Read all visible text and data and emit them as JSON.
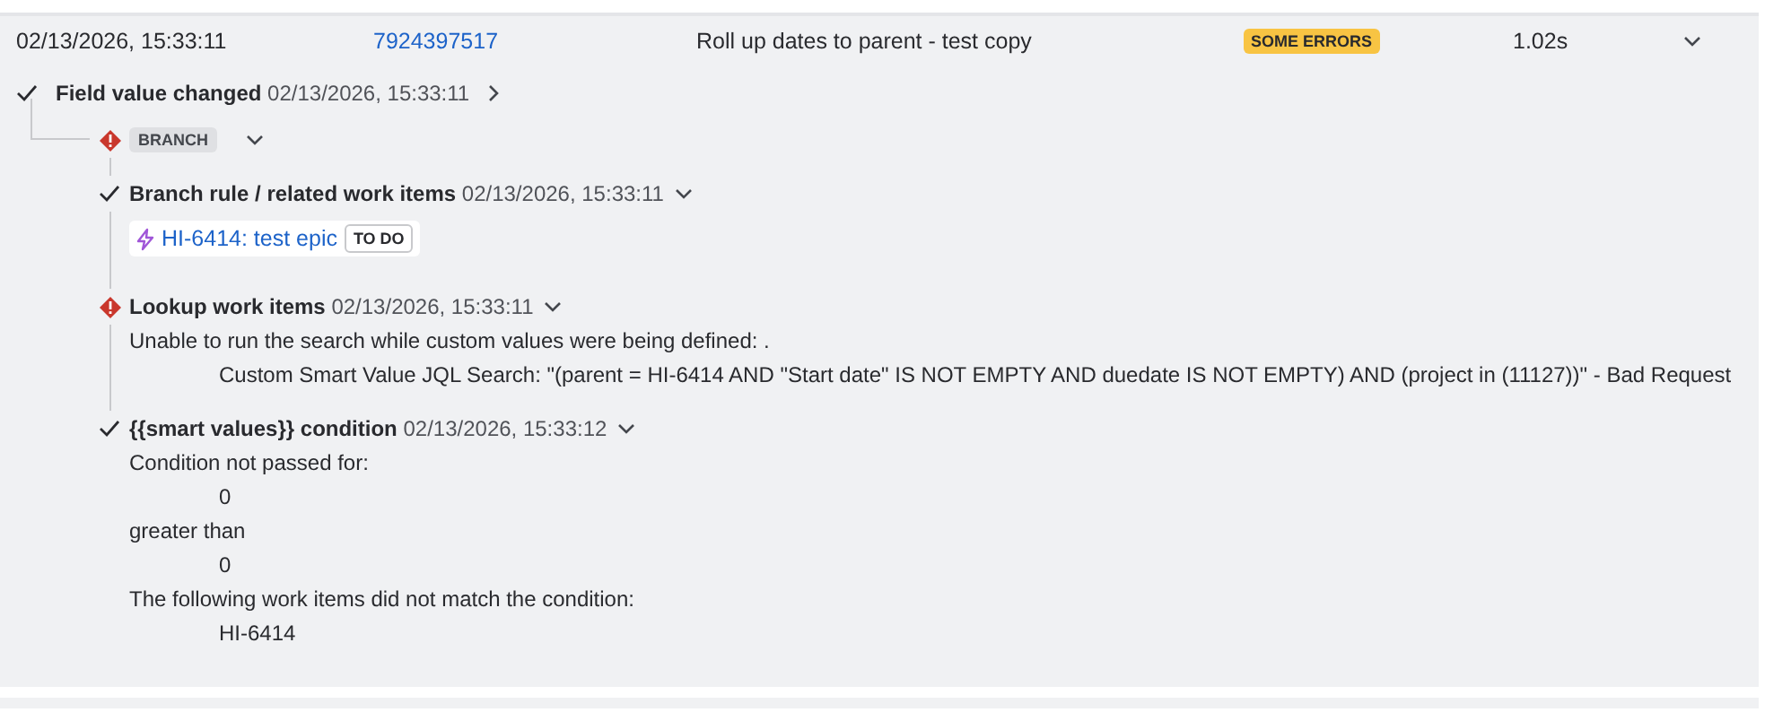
{
  "run": {
    "date": "02/13/2026, 15:33:11",
    "id": "7924397517",
    "rule": "Roll up dates to parent - test copy",
    "status": "SOME ERRORS",
    "duration": "1.02s",
    "expanded": true
  },
  "trigger": {
    "error": false,
    "title": "Field value changed",
    "time": "02/13/2026, 15:33:11",
    "expanded": false
  },
  "components": [
    {
      "kind": "branch",
      "error": true,
      "label": "BRANCH",
      "expanded": true,
      "children": [
        {
          "error": false,
          "title": "Branch rule / related work items",
          "time": "02/13/2026, 15:33:11",
          "expanded": true,
          "items": [
            {
              "key": "HI-6414: test epic",
              "status": "TO DO"
            }
          ]
        },
        {
          "error": true,
          "title": "Lookup work items",
          "time": "02/13/2026, 15:33:11",
          "expanded": true,
          "lines": [
            {
              "kind": "label",
              "text": "Unable to run the search while custom values were being defined: ."
            },
            {
              "kind": "value",
              "text": "Custom Smart Value JQL Search: \"(parent = HI-6414 AND \"Start date\" IS NOT EMPTY AND duedate IS NOT EMPTY) AND (project in (11127))\" - Bad Request"
            }
          ]
        }
      ]
    },
    {
      "kind": "step",
      "error": false,
      "title": "{{smart values}} condition",
      "time": "02/13/2026, 15:33:12",
      "expanded": true,
      "lines": [
        {
          "kind": "label",
          "text": "Condition not passed for:"
        },
        {
          "kind": "value",
          "text": "0"
        },
        {
          "kind": "label",
          "text": "greater than"
        },
        {
          "kind": "value",
          "text": "0"
        },
        {
          "kind": "label",
          "text": "The following work items did not match the condition:"
        },
        {
          "kind": "value",
          "text": "HI-6414"
        }
      ]
    }
  ]
}
